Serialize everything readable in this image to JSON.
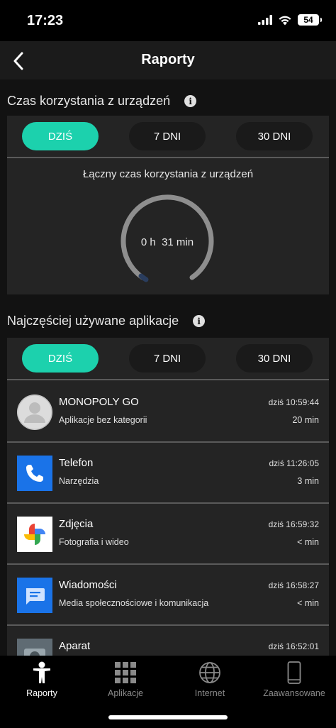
{
  "status_bar": {
    "time": "17:23",
    "battery": "54"
  },
  "nav": {
    "title": "Raporty"
  },
  "usage_section": {
    "title": "Czas korzystania z urządzeń",
    "tabs": [
      {
        "label": "DZIŚ",
        "active": true
      },
      {
        "label": "7 DNI",
        "active": false
      },
      {
        "label": "30 DNI",
        "active": false
      }
    ],
    "total_label": "Łączny czas korzystania z urządzeń",
    "total_value": "0 h  31 min"
  },
  "apps_section": {
    "title": "Najczęściej używane aplikacje",
    "tabs": [
      {
        "label": "DZIŚ",
        "active": true
      },
      {
        "label": "7 DNI",
        "active": false
      },
      {
        "label": "30 DNI",
        "active": false
      }
    ],
    "apps": [
      {
        "name": "MONOPOLY GO",
        "category": "Aplikacje bez kategorii",
        "time": "dziś 10:59:44",
        "duration": "20 min",
        "icon": "person-placeholder-icon"
      },
      {
        "name": "Telefon",
        "category": "Narzędzia",
        "time": "dziś 11:26:05",
        "duration": "3 min",
        "icon": "phone-icon"
      },
      {
        "name": "Zdjęcia",
        "category": "Fotografia i wideo",
        "time": "dziś 16:59:32",
        "duration": "< min",
        "icon": "photos-pinwheel-icon"
      },
      {
        "name": "Wiadomości",
        "category": "Media społecznościowe i komunikacja",
        "time": "dziś 16:58:27",
        "duration": "< min",
        "icon": "message-icon"
      },
      {
        "name": "Aparat",
        "category": "",
        "time": "dziś 16:52:01",
        "duration": "",
        "icon": "camera-icon"
      }
    ]
  },
  "tab_bar": {
    "items": [
      {
        "label": "Raporty",
        "icon": "person-report-icon",
        "active": true
      },
      {
        "label": "Aplikacje",
        "icon": "grid-icon",
        "active": false
      },
      {
        "label": "Internet",
        "icon": "globe-icon",
        "active": false
      },
      {
        "label": "Zaawansowane",
        "icon": "phone-device-icon",
        "active": false
      }
    ]
  },
  "colors": {
    "accent": "#1cd1ad",
    "background": "#121212",
    "card": "#242424"
  }
}
